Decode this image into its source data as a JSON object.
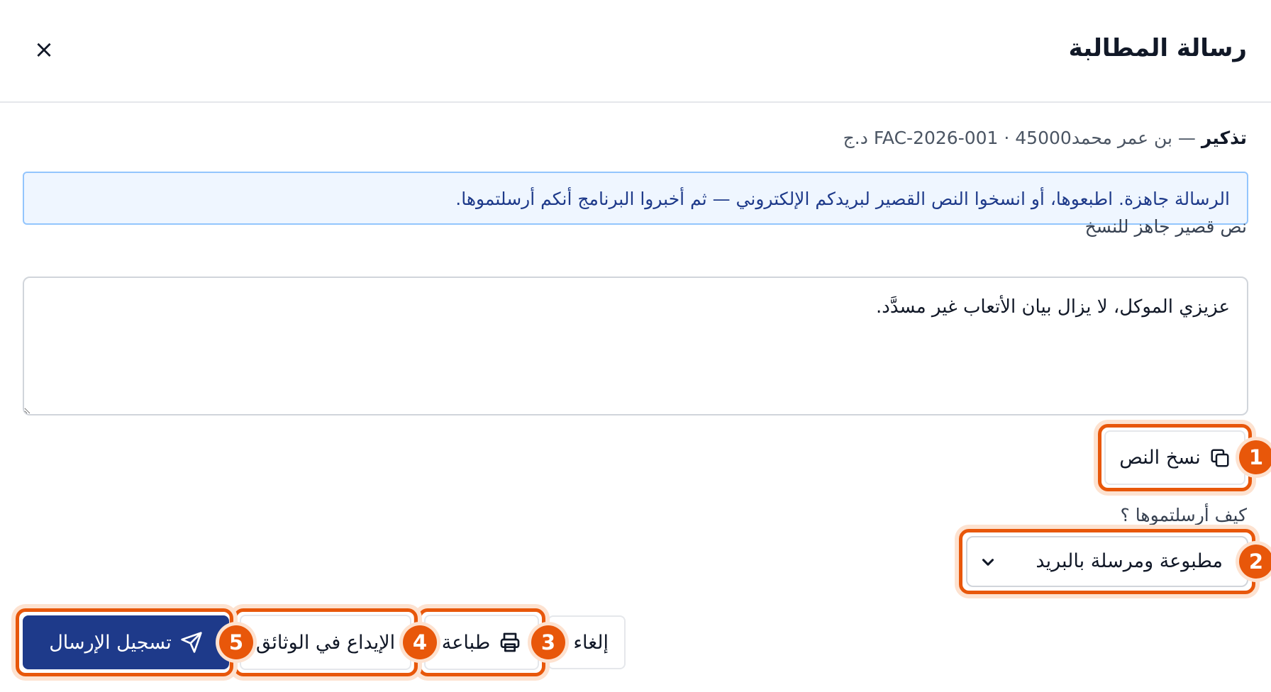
{
  "dialog": {
    "title": "رسالة المطالبة",
    "close_label": "×"
  },
  "summary": {
    "type": "تذكير",
    "details": "— بن عمر محمدFAC-2026-001 · 45000 د.ج"
  },
  "banner": {
    "text": "الرسالة جاهزة. اطبعوها، أو انسخوا النص القصير لبريدكم الإلكتروني — ثم أخبروا البرنامج أنكم أرسلتموها."
  },
  "short_text": {
    "label": "نص قصير جاهز للنسخ",
    "value": "عزيزي الموكل، لا يزال بيان الأتعاب غير مسدَّد."
  },
  "copy_button": {
    "label": "نسخ النص",
    "icon": "copy-icon"
  },
  "send_method": {
    "label": "كيف أرسلتموها ؟",
    "selected": "مطبوعة ومرسلة بالبريد"
  },
  "actions": {
    "cancel": "إلغاء",
    "print": "طباعة",
    "file": "الإيداع في الوثائق",
    "record": "تسجيل الإرسال"
  },
  "badges": [
    "1",
    "2",
    "3",
    "4",
    "5"
  ],
  "colors": {
    "accent": "#e8570a",
    "primary": "#1e3a8a",
    "banner_bg": "#eff6ff",
    "banner_border": "#93c5fd"
  }
}
